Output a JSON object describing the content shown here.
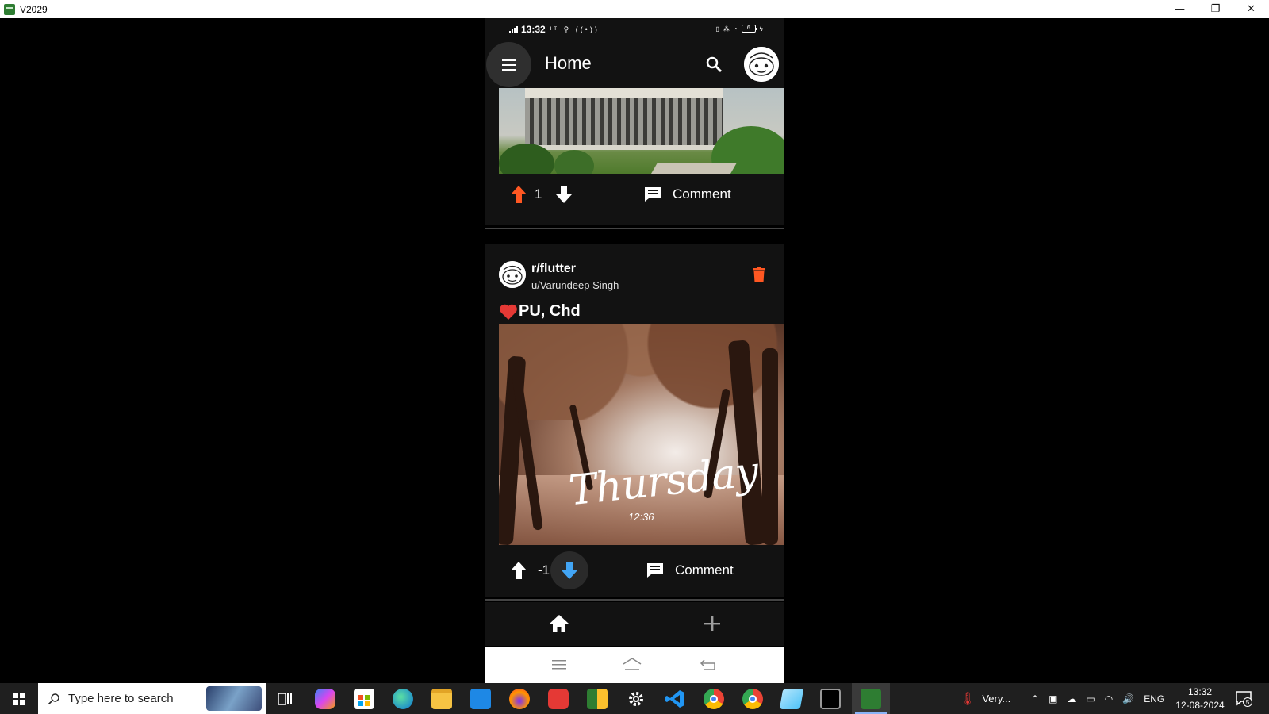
{
  "window": {
    "title": "V2029",
    "minimize": "—",
    "restore": "❐",
    "close": "✕"
  },
  "phone": {
    "status_bar": {
      "time": "13:32",
      "left_icons": "ᴵᵀ ⚲ ((•))",
      "battery": "6"
    },
    "app_bar": {
      "title": "Home"
    },
    "posts": [
      {
        "votes": "1",
        "vote_state": "up",
        "comment_label": "Comment"
      },
      {
        "subreddit": "r/flutter",
        "author": "u/Varundeep Singh",
        "title": "PU, Chd",
        "image_text": "Thursday",
        "image_time": "12:36",
        "votes": "-1",
        "vote_state": "down",
        "comment_label": "Comment"
      }
    ],
    "bottom_nav": {
      "items": [
        "home-icon",
        "add-icon"
      ]
    },
    "colors": {
      "upvote": "#ff5722",
      "downvote": "#42a5f5",
      "delete": "#ff5722",
      "surface": "#121212"
    }
  },
  "taskbar": {
    "search_placeholder": "Type here to search",
    "weather": "Very...",
    "language": "ENG",
    "time": "13:32",
    "date": "12-08-2024",
    "notification_count": "5"
  }
}
